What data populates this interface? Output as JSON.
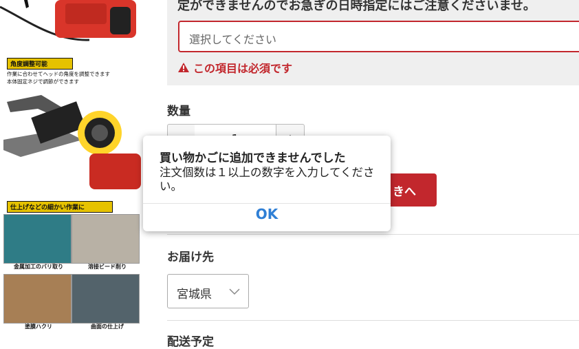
{
  "left_panel": {
    "tag1": "角度調整可能",
    "desc1_line1": "作業に合わせてヘッドの角度を調整できます",
    "desc1_line2": "本体固定ネジで調節ができます",
    "tag2": "仕上げなどの細かい作業に",
    "captions": [
      "金属加工のバリ取り",
      "溶接ビード削り",
      "塗膜ハクリ",
      "曲面の仕上げ"
    ]
  },
  "delivery_note": {
    "text": "定ができませんのでお急ぎの日時指定にはご注意くださいませ。",
    "select_placeholder": "選択してください",
    "error_text": "この項目は必須です"
  },
  "quantity": {
    "label": "数量",
    "minus": "−",
    "plus": "+",
    "value": "1"
  },
  "cart_button": {
    "label": "きへ"
  },
  "destination": {
    "label": "お届け先",
    "value": "宮城県"
  },
  "shipping": {
    "label": "配送予定"
  },
  "dialog": {
    "title": "買い物かごに追加できませんでした",
    "message": "注文個数は１以上の数字を入力してください。",
    "ok_label": "OK"
  },
  "colors": {
    "accent_red": "#c2272d",
    "link_blue": "#2f7fd5"
  }
}
